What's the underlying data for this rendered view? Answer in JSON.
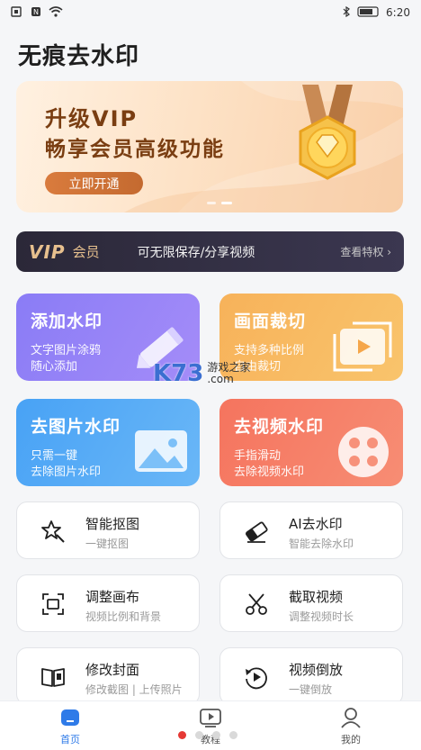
{
  "status_bar": {
    "left_icons": [
      "sim-icon",
      "nfc-icon",
      "wifi-icon"
    ],
    "right_icons": [
      "bluetooth-icon",
      "signal-icon"
    ],
    "time": "6:20"
  },
  "page_title": "无痕去水印",
  "banner": {
    "line1": "升级VIP",
    "line2": "畅享会员高级功能",
    "button": "立即开通"
  },
  "vip_bar": {
    "logo": "VIP",
    "word": "会员",
    "description": "可无限保存/分享视频",
    "link": "查看特权 ›"
  },
  "big_cards": [
    {
      "title": "添加水印",
      "sub1": "文字图片涂鸦",
      "sub2": "随心添加"
    },
    {
      "title": "画面裁切",
      "sub1": "支持多种比例",
      "sub2": "自由裁切"
    },
    {
      "title": "去图片水印",
      "sub1": "只需一键",
      "sub2": "去除图片水印"
    },
    {
      "title": "去视频水印",
      "sub1": "手指滑动",
      "sub2": "去除视频水印"
    }
  ],
  "watermark": {
    "logo": "K73",
    "line1": "游戏之家",
    "line2": ".com"
  },
  "tools": [
    {
      "title": "智能抠图",
      "sub": "一键抠图"
    },
    {
      "title": "AI去水印",
      "sub": "智能去除水印"
    },
    {
      "title": "调整画布",
      "sub": "视频比例和背景"
    },
    {
      "title": "截取视频",
      "sub": "调整视频时长"
    },
    {
      "title": "修改封面",
      "sub": "修改截图 | 上传照片"
    },
    {
      "title": "视频倒放",
      "sub": "一键倒放"
    }
  ],
  "tab_bar": {
    "home": "首页",
    "tutorial": "教程",
    "mine": "我的"
  },
  "colors": {
    "accent": "#2f7be8",
    "banner_text": "#7a3e12",
    "vip_gold": "#e7c08e"
  }
}
